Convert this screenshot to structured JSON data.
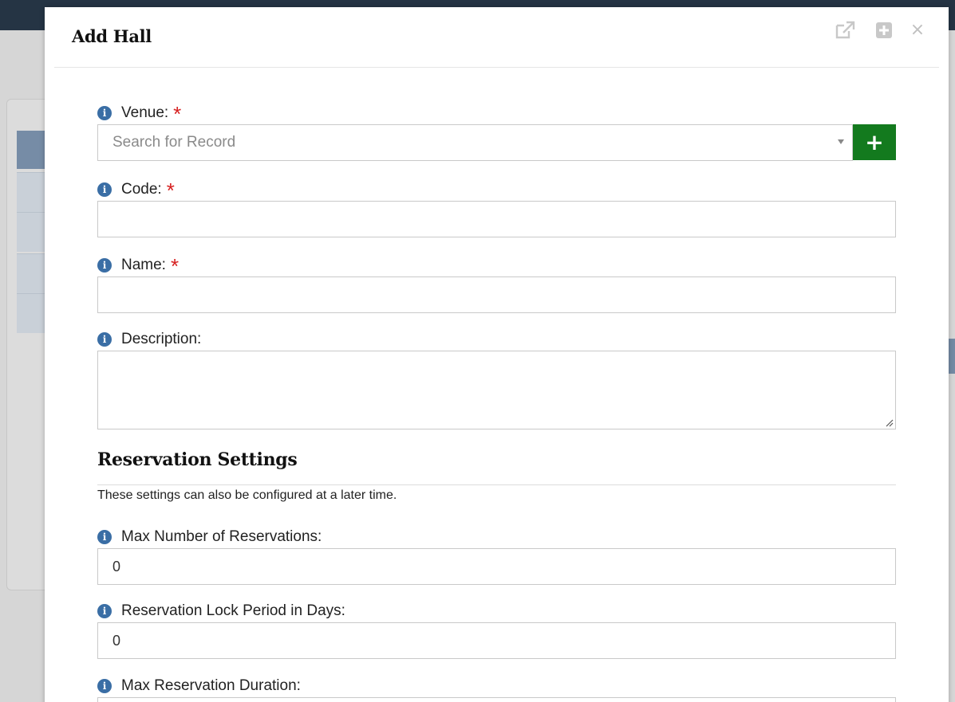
{
  "modal": {
    "title": "Add Hall",
    "header_icons": [
      "external-link-icon",
      "plus-square-icon",
      "close-icon"
    ],
    "close_glyph": "×"
  },
  "form": {
    "venue": {
      "label": "Venue:",
      "required": "*",
      "placeholder": "Search for Record",
      "add_glyph": "+"
    },
    "code": {
      "label": "Code:",
      "required": "*",
      "value": ""
    },
    "name": {
      "label": "Name:",
      "required": "*",
      "value": ""
    },
    "description": {
      "label": "Description:",
      "value": ""
    },
    "reservation_settings": {
      "title": "Reservation Settings",
      "note": "These settings can also be configured at a later time.",
      "max_reservations": {
        "label": "Max Number of Reservations:",
        "value": "0"
      },
      "lock_period": {
        "label": "Reservation Lock Period in Days:",
        "value": "0"
      },
      "max_duration": {
        "label": "Max Reservation Duration:",
        "value": ""
      }
    }
  },
  "colors": {
    "accent_blue": "#3a6ea5",
    "add_button_green": "#137a1e",
    "required_red": "#d62020"
  }
}
